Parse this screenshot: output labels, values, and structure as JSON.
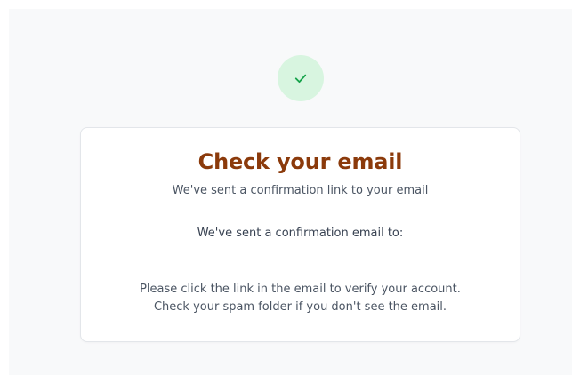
{
  "icons": {
    "success": "check-icon"
  },
  "colors": {
    "page_background": "#f8f9fa",
    "title": "#8b3a0b",
    "success_badge": "#d8f5e0",
    "success_icon": "#16a34a"
  },
  "card": {
    "title": "Check your email",
    "subtitle": "We've sent a confirmation link to your email",
    "sent_to_label": "We've sent a confirmation email to:",
    "instructions": [
      "Please click the link in the email to verify your account.",
      "Check your spam folder if you don't see the email."
    ]
  }
}
